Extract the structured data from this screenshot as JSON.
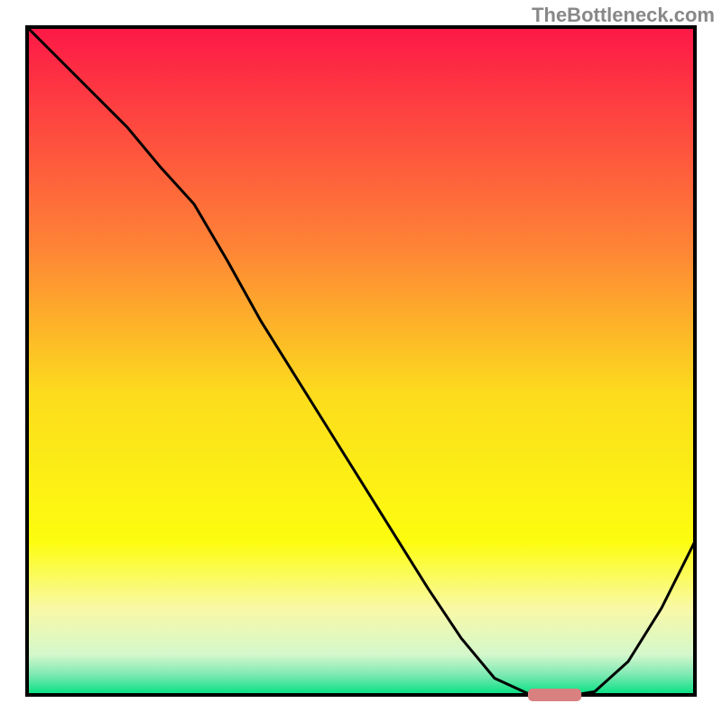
{
  "watermark": "TheBottleneck.com",
  "chart_data": {
    "type": "line",
    "title": "",
    "xlabel": "",
    "ylabel": "",
    "xlim": [
      0,
      100
    ],
    "ylim": [
      0,
      100
    ],
    "x": [
      0,
      5,
      10,
      15,
      20,
      25,
      30,
      35,
      40,
      45,
      50,
      55,
      60,
      65,
      70,
      75,
      80,
      82,
      85,
      90,
      95,
      100
    ],
    "values": [
      100,
      95,
      90,
      85,
      79,
      73.5,
      65,
      56,
      48,
      40,
      32,
      24,
      16,
      8.5,
      2.5,
      0.2,
      0,
      0,
      0.5,
      5,
      13,
      23
    ],
    "marker": {
      "x_range": [
        75,
        83
      ],
      "y": 0,
      "color": "#d98080"
    },
    "background_gradient": {
      "type": "vertical",
      "stops": [
        {
          "offset": 0.0,
          "color": "#fd1847"
        },
        {
          "offset": 0.33,
          "color": "#fe8436"
        },
        {
          "offset": 0.55,
          "color": "#fcdc1d"
        },
        {
          "offset": 0.77,
          "color": "#fdfd0f"
        },
        {
          "offset": 0.87,
          "color": "#f9f9a6"
        },
        {
          "offset": 0.94,
          "color": "#d4f7cc"
        },
        {
          "offset": 0.97,
          "color": "#7ce9b3"
        },
        {
          "offset": 1.0,
          "color": "#00e080"
        }
      ]
    }
  },
  "frame": {
    "border_color": "#000000",
    "border_width": 4
  }
}
